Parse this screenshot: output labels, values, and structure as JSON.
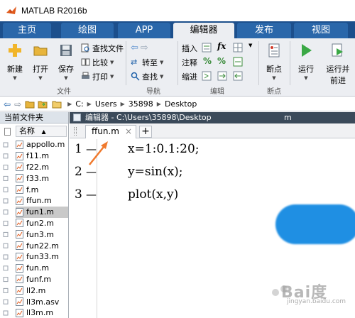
{
  "window": {
    "title": "MATLAB R2016b"
  },
  "ribbon_tabs": [
    {
      "label": "主页",
      "active": false
    },
    {
      "label": "绘图",
      "active": false
    },
    {
      "label": "APP",
      "active": false
    },
    {
      "label": "编辑器",
      "active": true
    },
    {
      "label": "发布",
      "active": false
    },
    {
      "label": "视图",
      "active": false
    }
  ],
  "ribbon": {
    "file_group": {
      "label": "文件",
      "new": "新建",
      "open": "打开",
      "save": "保存",
      "find_files": "查找文件",
      "compare": "比较",
      "print": "打印"
    },
    "navigate_group": {
      "label": "导航",
      "goto": "转至",
      "find": "查找"
    },
    "edit_group": {
      "label": "编辑",
      "insert": "插入",
      "comment": "注释",
      "indent": "缩进",
      "fx": "fx"
    },
    "breakpoint_group": {
      "label": "断点",
      "breakpoints": "断点"
    },
    "run_group": {
      "run": "运行",
      "run_advance": "运行并",
      "run_advance_line2": "前进"
    }
  },
  "address_bar": {
    "path": [
      "C:",
      "Users",
      "35898",
      "Desktop"
    ]
  },
  "current_folder": {
    "title": "当前文件夹",
    "column_name": "名称",
    "files": [
      {
        "name": "appollo.m",
        "selected": false
      },
      {
        "name": "f11.m",
        "selected": false
      },
      {
        "name": "f22.m",
        "selected": false
      },
      {
        "name": "f33.m",
        "selected": false
      },
      {
        "name": "f.m",
        "selected": false
      },
      {
        "name": "ffun.m",
        "selected": false
      },
      {
        "name": "fun1.m",
        "selected": true
      },
      {
        "name": "fun2.m",
        "selected": false
      },
      {
        "name": "fun3.m",
        "selected": false
      },
      {
        "name": "fun22.m",
        "selected": false
      },
      {
        "name": "fun33.m",
        "selected": false
      },
      {
        "name": "fun.m",
        "selected": false
      },
      {
        "name": "funf.m",
        "selected": false
      },
      {
        "name": "ll2.m",
        "selected": false
      },
      {
        "name": "ll3m.asv",
        "selected": false
      },
      {
        "name": "ll3m.m",
        "selected": false
      }
    ]
  },
  "editor": {
    "title": "编辑器 - C:\\Users\\35898\\Desktop",
    "title_suffix": "m",
    "tab_label": "ffun.m",
    "new_tab": "+",
    "lines": [
      {
        "num": "1",
        "code": "x=1:0.1:20;"
      },
      {
        "num": "2",
        "code": "y=sin(x);"
      },
      {
        "num": "3",
        "code": "plot(x,y)"
      }
    ]
  },
  "watermark": {
    "text": "Bai度",
    "sub": "jingyan.baidu.com"
  },
  "colors": {
    "tab_bar": "#1c4f8c",
    "ribbon_bg": "#eceef2",
    "selected_row": "#c9c9c9",
    "arrow": "#f07a2e",
    "redaction": "#1f8fe3"
  }
}
